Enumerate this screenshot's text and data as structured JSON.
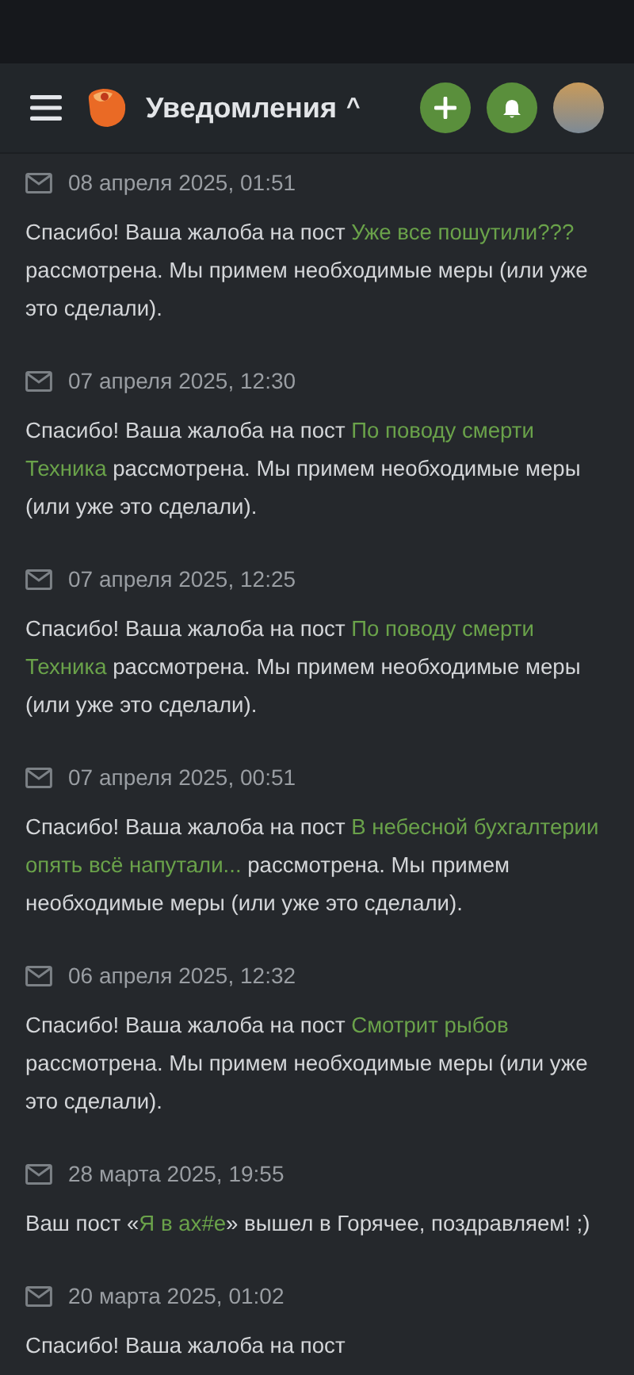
{
  "header": {
    "title": "Уведомления",
    "title_caret": "^"
  },
  "notifications": [
    {
      "date": "08 апреля 2025, 01:51",
      "parts": [
        {
          "kind": "text",
          "text": "Спасибо! Ваша жалоба на пост "
        },
        {
          "kind": "link",
          "text": "Уже все пошутили???"
        },
        {
          "kind": "text",
          "text": " рассмотрена. Мы примем необходимые меры (или уже это сделали)."
        }
      ]
    },
    {
      "date": "07 апреля 2025, 12:30",
      "parts": [
        {
          "kind": "text",
          "text": "Спасибо! Ваша жалоба на пост "
        },
        {
          "kind": "link",
          "lines": [
            "По поводу смерти",
            "Техника"
          ]
        },
        {
          "kind": "text",
          "text": " рассмотрена. Мы примем необходимые меры (или уже это сделали)."
        }
      ]
    },
    {
      "date": "07 апреля 2025, 12:25",
      "parts": [
        {
          "kind": "text",
          "text": "Спасибо! Ваша жалоба на пост "
        },
        {
          "kind": "link",
          "lines": [
            "По поводу смерти",
            "Техника"
          ]
        },
        {
          "kind": "text",
          "text": " рассмотрена. Мы примем необходимые меры (или уже это сделали)."
        }
      ]
    },
    {
      "date": "07 апреля 2025, 00:51",
      "parts": [
        {
          "kind": "text",
          "text": "Спасибо! Ваша жалоба на пост "
        },
        {
          "kind": "link",
          "lines": [
            "В небесной бухгалтерии",
            "опять всё напутали..."
          ]
        },
        {
          "kind": "text",
          "text": " рассмотрена. Мы примем необходимые меры (или уже это сделали)."
        }
      ]
    },
    {
      "date": "06 апреля 2025, 12:32",
      "parts": [
        {
          "kind": "text",
          "text": "Спасибо! Ваша жалоба на пост "
        },
        {
          "kind": "link",
          "text": "Смотрит рыбов"
        },
        {
          "kind": "text",
          "text": " рассмотрена. Мы примем необходимые меры (или уже это сделали)."
        }
      ]
    },
    {
      "date": "28 марта 2025, 19:55",
      "parts": [
        {
          "kind": "text",
          "text": "Ваш пост «"
        },
        {
          "kind": "link",
          "text": "Я в ах#е"
        },
        {
          "kind": "text",
          "text": "» вышел в Горячее, поздравляем! ;)"
        }
      ]
    },
    {
      "date": "20 марта 2025, 01:02",
      "parts": [
        {
          "kind": "text",
          "text": "Спасибо! Ваша жалоба на пост"
        }
      ]
    }
  ]
}
